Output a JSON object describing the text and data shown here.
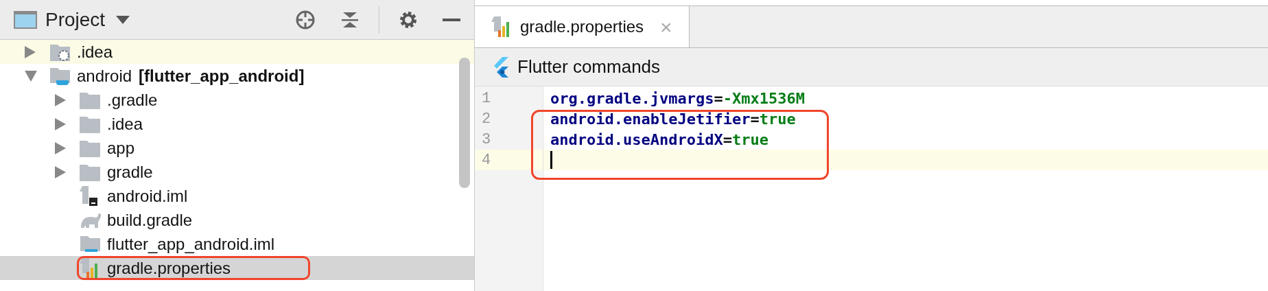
{
  "project_panel": {
    "title": "Project",
    "tree": [
      {
        "name": ".idea",
        "kind": "special-folder",
        "expanded": false,
        "selected": false,
        "highlighted": true
      },
      {
        "name": "android",
        "module": "[flutter_app_android]",
        "kind": "module",
        "expanded": true,
        "selected": false,
        "highlighted": false,
        "children": [
          {
            "name": ".gradle",
            "kind": "folder",
            "expanded": false,
            "selected": false,
            "highlighted": false
          },
          {
            "name": ".idea",
            "kind": "folder",
            "expanded": false,
            "selected": false,
            "highlighted": false
          },
          {
            "name": "app",
            "kind": "folder",
            "expanded": false,
            "selected": false,
            "highlighted": false
          },
          {
            "name": "gradle",
            "kind": "folder",
            "expanded": false,
            "selected": false,
            "highlighted": false
          },
          {
            "name": "android.iml",
            "kind": "iml",
            "selected": false,
            "highlighted": false
          },
          {
            "name": "build.gradle",
            "kind": "gradle",
            "selected": false,
            "highlighted": false
          },
          {
            "name": "flutter_app_android.iml",
            "kind": "module-iml",
            "selected": false,
            "highlighted": false
          },
          {
            "name": "gradle.properties",
            "kind": "properties",
            "selected": true,
            "highlighted": false,
            "callout": true
          }
        ]
      }
    ]
  },
  "editor": {
    "tabs": [
      {
        "label": "gradle.properties",
        "close": "×",
        "selected": true
      }
    ],
    "toolbar": {
      "label": "Flutter commands"
    },
    "lines": [
      {
        "number": "1",
        "current": false,
        "callout": false,
        "tokens": [
          {
            "kind": "key",
            "text": "org.gradle.jvmargs"
          },
          {
            "kind": "op",
            "text": "="
          },
          {
            "kind": "value",
            "text": "-Xmx1536M"
          }
        ]
      },
      {
        "number": "2",
        "current": false,
        "callout": true,
        "tokens": [
          {
            "kind": "key",
            "text": "android.enableJetifier"
          },
          {
            "kind": "op",
            "text": "="
          },
          {
            "kind": "value",
            "text": "true"
          }
        ]
      },
      {
        "number": "3",
        "current": false,
        "callout": true,
        "tokens": [
          {
            "kind": "key",
            "text": "android.useAndroidX"
          },
          {
            "kind": "op",
            "text": "="
          },
          {
            "kind": "value",
            "text": "true"
          }
        ]
      },
      {
        "number": "4",
        "current": true,
        "callout": true
      }
    ]
  }
}
